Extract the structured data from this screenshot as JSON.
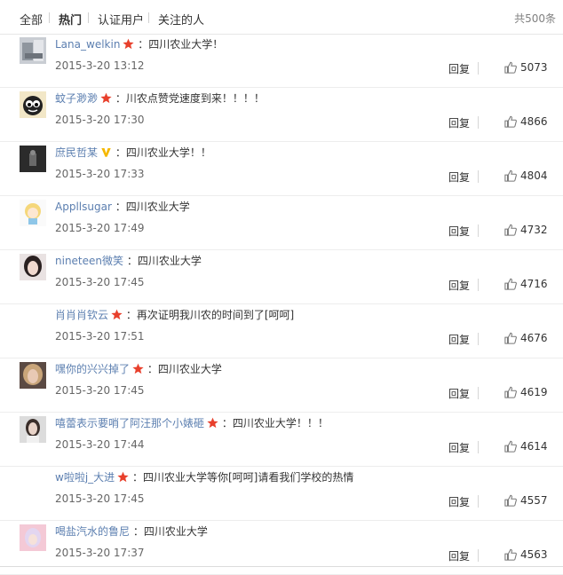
{
  "tabs": [
    {
      "label": "全部",
      "active": false
    },
    {
      "label": "热门",
      "active": true
    },
    {
      "label": "认证用户",
      "active": false
    },
    {
      "label": "关注的人",
      "active": false
    }
  ],
  "total_label": "共500条",
  "reply_label": "回复",
  "colors": {
    "username_orange": "#eb7350",
    "username_blue": "#5c7fb0",
    "star_red": "#e8402c",
    "vip_gold": "#f5b800"
  },
  "comments": [
    {
      "user": "Lana_welkin",
      "badge": "star-icon",
      "text": "四川农业大学！",
      "time": "2015-3-20 13:12",
      "likes": "5073",
      "avatar": "photo-avatar",
      "name_color": "blue"
    },
    {
      "user": "蚊子渺渺",
      "badge": "star-icon",
      "text": "川农点赞党速度到来！！！！",
      "time": "2015-3-20 17:30",
      "likes": "4866",
      "avatar": "cartoon-face-avatar",
      "name_color": "blue"
    },
    {
      "user": "庶民哲某",
      "badge": "vip-v-icon",
      "text": "四川农业大学！！",
      "time": "2015-3-20 17:33",
      "likes": "4804",
      "avatar": "dark-photo-avatar",
      "name_color": "blue"
    },
    {
      "user": "Appllsugar",
      "badge": "",
      "text": "四川农业大学",
      "time": "2015-3-20 17:49",
      "likes": "4732",
      "avatar": "cartoon-girl-avatar",
      "name_color": "blue"
    },
    {
      "user": "nineteen微笑",
      "badge": "",
      "text": "四川农业大学",
      "time": "2015-3-20 17:45",
      "likes": "4716",
      "avatar": "girl-photo-avatar",
      "name_color": "blue"
    },
    {
      "user": "肖肖肖钦云",
      "badge": "star-icon",
      "text": "再次证明我川农的时间到了[呵呵]",
      "time": "2015-3-20 17:51",
      "likes": "4676",
      "avatar": "",
      "name_color": "blue"
    },
    {
      "user": "嘿你的兴兴掉了",
      "badge": "star-icon",
      "text": "四川农业大学",
      "time": "2015-3-20 17:45",
      "likes": "4619",
      "avatar": "blonde-photo-avatar",
      "name_color": "blue"
    },
    {
      "user": "嘻蕾表示要哨了阿汪那个小婊砸",
      "badge": "star-icon",
      "text": "四川农业大学！！！",
      "time": "2015-3-20 17:44",
      "likes": "4614",
      "avatar": "woman-photo-avatar",
      "name_color": "blue"
    },
    {
      "user": "w啦啦j_大进",
      "badge": "star-icon",
      "text": "四川农业大学等你[呵呵]请看我们学校的热情",
      "time": "2015-3-20 17:45",
      "likes": "4557",
      "avatar": "",
      "name_color": "blue"
    },
    {
      "user": "喝盐汽水的鲁尼",
      "badge": "",
      "text": "四川农业大学",
      "time": "2015-3-20 17:37",
      "likes": "4563",
      "avatar": "pink-photo-avatar",
      "name_color": "blue"
    }
  ]
}
